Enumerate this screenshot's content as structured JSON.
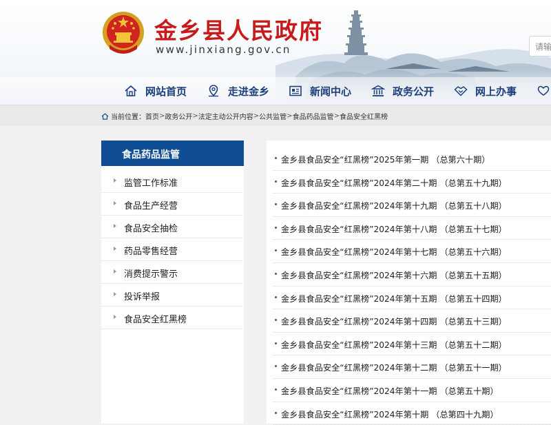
{
  "header": {
    "site_title": "金乡县人民政府",
    "site_url": "www.jinxiang.gov.cn",
    "search_placeholder": "请输入",
    "nav": [
      {
        "label": "网站首页",
        "icon": "home-icon"
      },
      {
        "label": "走进金乡",
        "icon": "location-pin-icon"
      },
      {
        "label": "新闻中心",
        "icon": "newspaper-icon"
      },
      {
        "label": "政务公开",
        "icon": "government-building-icon"
      },
      {
        "label": "网上办事",
        "icon": "handshake-icon"
      }
    ]
  },
  "breadcrumb": {
    "prefix": "当前位置：",
    "items": [
      "首页",
      "政务公开",
      "法定主动公开内容",
      "公共监管",
      "食品药品监管",
      "食品安全红黑榜"
    ],
    "separator": ">"
  },
  "sidebar": {
    "title": "食品药品监管",
    "items": [
      {
        "label": "监管工作标准"
      },
      {
        "label": "食品生产经营"
      },
      {
        "label": "食品安全抽检"
      },
      {
        "label": "药品零售经营"
      },
      {
        "label": "消费提示警示"
      },
      {
        "label": "投诉举报"
      },
      {
        "label": "食品安全红黑榜"
      }
    ]
  },
  "list": {
    "items": [
      {
        "title": "金乡县食品安全“红黑榜”2025年第一期 （总第六十期）"
      },
      {
        "title": "金乡县食品安全“红黑榜”2024年第二十期 （总第五十九期）"
      },
      {
        "title": "金乡县食品安全“红黑榜”2024年第十九期 （总第五十八期）"
      },
      {
        "title": "金乡县食品安全“红黑榜”2024年第十八期 （总第五十七期）"
      },
      {
        "title": "金乡县食品安全“红黑榜”2024年第十七期 （总第五十六期）"
      },
      {
        "title": "金乡县食品安全“红黑榜”2024年第十六期 （总第五十五期）"
      },
      {
        "title": "金乡县食品安全“红黑榜”2024年第十五期 （总第五十四期）"
      },
      {
        "title": "金乡县食品安全“红黑榜”2024年第十四期 （总第五十三期）"
      },
      {
        "title": "金乡县食品安全“红黑榜”2024年第十三期 （总第五十二期）"
      },
      {
        "title": "金乡县食品安全“红黑榜”2024年第十二期 （总第五十一期）"
      },
      {
        "title": "金乡县食品安全“红黑榜”2024年第十一期 （总第五十期）"
      },
      {
        "title": "金乡县食品安全“红黑榜”2024年第十期 （总第四十九期）"
      }
    ]
  },
  "colors": {
    "title_red": "#c71a1a",
    "nav_blue": "#1c3f7a",
    "sidebar_header_blue": "#0f4d95"
  }
}
